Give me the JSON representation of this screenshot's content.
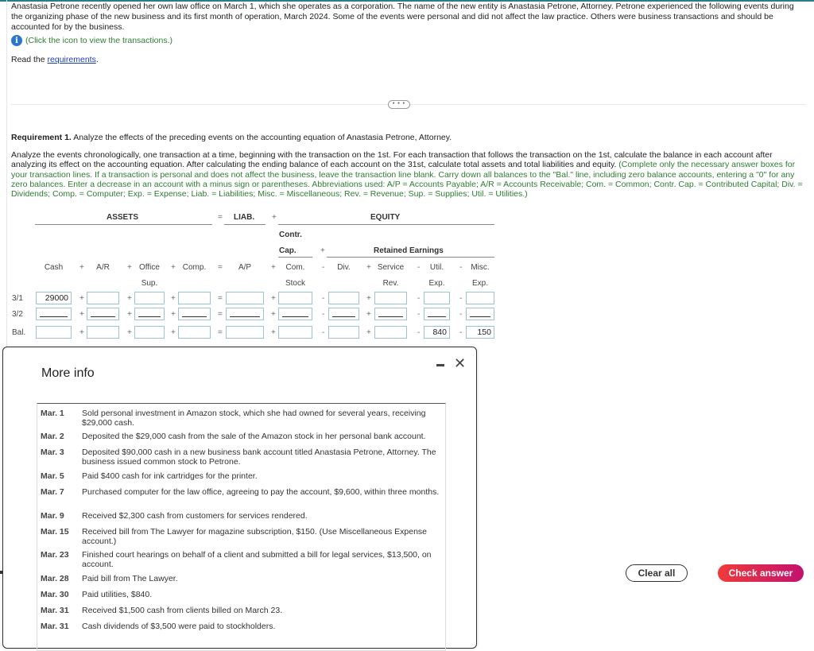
{
  "intro": {
    "text": "Anastasia Petrone recently opened her own law office on March 1, which she operates as a corporation. The name of the new entity is Anastasia Petrone, Attorney. Petrone experienced the following events during the organizing phase of the new business and its first month of operation, March 2024. Some of the events were personal and did not affect the law practice. Others were business transactions and should be accounted for by the business.",
    "info_hint": "(Click the icon to view the transactions.)",
    "read_prefix": "Read the ",
    "read_link": "requirements",
    "read_suffix": "."
  },
  "expander_label": "• • •",
  "requirement": {
    "label": "Requirement 1.",
    "text": " Analyze the effects of the preceding events on the accounting equation of Anastasia Petrone, Attorney.",
    "instructions": "Analyze the events chronologically, one transaction at a time, beginning with the transaction on the 1st. For each transaction that follows the transaction on the 1st, calculate the balance in each account after analyzing its effect on the accounting equation. After calculating the ending balance of each account on the 31st, calculate total assets and total liabilities and equity. ",
    "instructions_green": "(Complete only the necessary answer boxes for your transaction lines. If a transaction is personal and does not affect the business, leave the transaction line blank. Carry down all balances to the \"Bal.\" line, including zero balance accounts, entering a \"0\" for any zero balances. Enter a decrease in an account with a minus sign or parentheses. Abbreviations used: A/P = Accounts Payable; A/R = Accounts Receivable; Com. = Common; Contr. Cap. = Contributed Capital; Div. = Dividends; Comp. = Computer; Exp. = Expense; Liab. = Liabilities; Misc. = Miscellaneous; Rev. = Revenue; Sup. = Supplies; Util. = Utilities.)"
  },
  "equation": {
    "groups": {
      "assets": "ASSETS",
      "eq": "=",
      "liab": "LIAB.",
      "plus": "+",
      "equity": "EQUITY",
      "contr1": "Contr.",
      "contr2": "Cap.",
      "plus2": "+",
      "retained": "Retained Earnings"
    },
    "columns": [
      {
        "op": "",
        "l1": "Cash",
        "l2": ""
      },
      {
        "op": "+",
        "l1": "A/R",
        "l2": ""
      },
      {
        "op": "+",
        "l1": "Office",
        "l2": "Sup."
      },
      {
        "op": "+",
        "l1": "Comp.",
        "l2": ""
      },
      {
        "op": "=",
        "l1": "A/P",
        "l2": ""
      },
      {
        "op": "+",
        "l1": "Com.",
        "l2": "Stock"
      },
      {
        "op": "-",
        "l1": "Div.",
        "l2": ""
      },
      {
        "op": "+",
        "l1": "Service",
        "l2": "Rev."
      },
      {
        "op": "-",
        "l1": "Util.",
        "l2": "Exp."
      },
      {
        "op": "-",
        "l1": "Misc.",
        "l2": "Exp."
      }
    ],
    "rows": [
      {
        "label": "3/1",
        "values": [
          "29000",
          "",
          "",
          "",
          "",
          "",
          "",
          "",
          "",
          ""
        ],
        "underline": false
      },
      {
        "label": "3/2",
        "values": [
          "",
          "",
          "",
          "",
          "",
          "",
          "",
          "",
          "",
          ""
        ],
        "underline": true
      },
      {
        "label": "Bal.",
        "values": [
          "",
          "",
          "",
          "",
          "",
          "",
          "",
          "",
          "840",
          "150"
        ],
        "underline": false
      }
    ]
  },
  "modal": {
    "title": "More info",
    "transactions": [
      {
        "date": "Mar. 1",
        "desc": "Sold personal investment in Amazon stock, which she had owned for several years, receiving $29,000 cash."
      },
      {
        "date": "Mar. 2",
        "desc": "Deposited the $29,000 cash from the sale of the Amazon stock in her personal bank account."
      },
      {
        "date": "Mar. 3",
        "desc": "Deposited $90,000 cash in a new business bank account titled Anastasia Petrone, Attorney. The business issued common stock to Petrone."
      },
      {
        "date": "Mar. 5",
        "desc": "Paid $400 cash for ink cartridges for the printer."
      },
      {
        "date": "Mar. 7",
        "desc": "Purchased computer for the law office, agreeing to pay the account, $9,600, within three months."
      },
      {
        "date": "Mar. 9",
        "desc": "Received $2,300 cash from customers for services rendered."
      },
      {
        "date": "Mar. 15",
        "desc": "Received bill from The Lawyer for magazine subscription, $150. (Use Miscellaneous Expense account.)"
      },
      {
        "date": "Mar. 23",
        "desc": "Finished court hearings on behalf of a client and submitted a bill for legal services, $13,500, on account."
      },
      {
        "date": "Mar. 28",
        "desc": "Paid bill from The Lawyer."
      },
      {
        "date": "Mar. 30",
        "desc": "Paid utilities, $840."
      },
      {
        "date": "Mar. 31",
        "desc": "Received $1,500 cash from clients billed on March 23."
      },
      {
        "date": "Mar. 31",
        "desc": "Cash dividends of $3,500 were paid to stockholders."
      }
    ]
  },
  "buttons": {
    "clear": "Clear all",
    "check": "Check answer"
  }
}
